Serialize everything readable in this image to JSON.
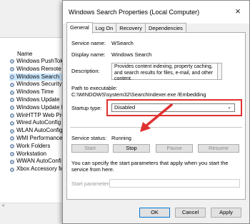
{
  "services": {
    "header": "Name",
    "left_marker": "e-",
    "items": [
      {
        "label": "Windows PushTok",
        "selected": false
      },
      {
        "label": "Windows Remote",
        "selected": false
      },
      {
        "label": "Windows Search",
        "selected": true
      },
      {
        "label": "Windows Security",
        "selected": false
      },
      {
        "label": "Windows Time",
        "selected": false
      },
      {
        "label": "Windows Update",
        "selected": false
      },
      {
        "label": "Windows Update M",
        "selected": false
      },
      {
        "label": "WinHTTP Web Pro",
        "selected": false
      },
      {
        "label": "Wired AutoConfig",
        "selected": false
      },
      {
        "label": "WLAN AutoConfig",
        "selected": false
      },
      {
        "label": "WMI Performance",
        "selected": false
      },
      {
        "label": "Work Folders",
        "selected": false
      },
      {
        "label": "Workstation",
        "selected": false
      },
      {
        "label": "WWAN AutoConfi",
        "selected": false
      },
      {
        "label": "Xbox Accessory M",
        "selected": false
      }
    ],
    "scroll_left": "<"
  },
  "dialog": {
    "title": "Windows Search Properties (Local Computer)",
    "close_glyph": "×",
    "tabs": [
      {
        "label": "General",
        "active": true
      },
      {
        "label": "Log On",
        "active": false
      },
      {
        "label": "Recovery",
        "active": false
      },
      {
        "label": "Dependencies",
        "active": false
      }
    ],
    "service_name_label": "Service name:",
    "service_name_value": "WSearch",
    "display_name_label": "Display name:",
    "display_name_value": "Windows Search",
    "description_label": "Description:",
    "description_value": "Provides content indexing, property caching, and search results for files, e-mail, and other content.",
    "path_label": "Path to executable:",
    "path_value": "C:\\WINDOWS\\system32\\SearchIndexer.exe /Embedding",
    "startup_label": "Startup type:",
    "startup_value": "Disabled",
    "status_label": "Service status:",
    "status_value": "Running",
    "buttons": {
      "start": "Start",
      "stop": "Stop",
      "pause": "Pause",
      "resume": "Resume"
    },
    "hint": "You can specify the start parameters that apply when you start the service from here.",
    "params_label": "Start parameters:",
    "params_value": "",
    "ok": "OK",
    "cancel": "Cancel",
    "apply": "Apply"
  },
  "colors": {
    "highlight": "#e03131",
    "selection": "#cce8ff",
    "default_button_border": "#0078d7"
  },
  "icons": {
    "service": "gear-icon",
    "dropdown": "chevron-down-icon",
    "close": "close-icon",
    "annotation": "red-arrow"
  }
}
